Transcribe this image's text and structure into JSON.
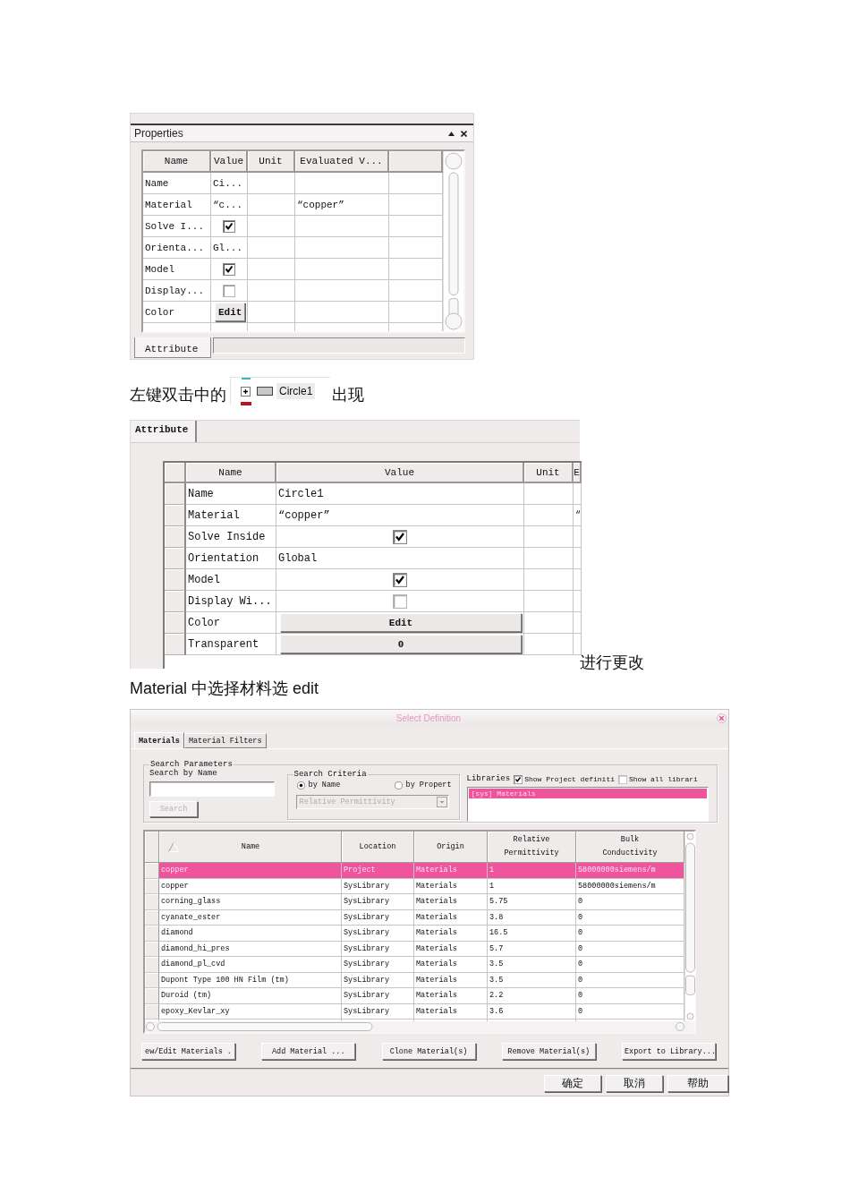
{
  "properties_panel": {
    "title": "Properties",
    "columns": [
      "Name",
      "Value",
      "Unit",
      "Evaluated V..."
    ],
    "rows": [
      {
        "kind": "text",
        "name": "Name",
        "value": "Ci..."
      },
      {
        "kind": "text",
        "name": "Material",
        "value": "“c...",
        "evaluated": "“copper”"
      },
      {
        "kind": "checkbox",
        "name": "Solve I...",
        "checked": true
      },
      {
        "kind": "text",
        "name": "Orienta...",
        "value": "Gl..."
      },
      {
        "kind": "checkbox",
        "name": "Model",
        "checked": true
      },
      {
        "kind": "checkbox",
        "name": "Display...",
        "checked": false
      },
      {
        "kind": "button",
        "name": "Color",
        "value": "Edit"
      }
    ],
    "tab": "Attribute"
  },
  "instruction_1": {
    "before": "左键双击中的",
    "tree_item": {
      "label": "Circle1"
    },
    "after": "出现"
  },
  "attribute_panel": {
    "tab": "Attribute",
    "columns": [
      "Name",
      "Value",
      "Unit",
      "E"
    ],
    "rows": [
      {
        "kind": "text",
        "name": "Name",
        "value": "Circle1"
      },
      {
        "kind": "text",
        "name": "Material",
        "value": "“copper”",
        "column_4": "“"
      },
      {
        "kind": "checkbox",
        "name": "Solve Inside",
        "checked": true
      },
      {
        "kind": "text",
        "name": "Orientation",
        "value": "Global"
      },
      {
        "kind": "checkbox",
        "name": "Model",
        "checked": true
      },
      {
        "kind": "checkbox",
        "name": "Display Wi...",
        "checked": false
      },
      {
        "kind": "button",
        "name": "Color",
        "value": "Edit"
      },
      {
        "kind": "button",
        "name": "Transparent",
        "value": "0"
      }
    ]
  },
  "instruction_2": "进行更改",
  "instruction_3": "Material 中选择材料选 edit",
  "select_definition": {
    "title": "Select Definition",
    "tabs": [
      {
        "label": "Materials",
        "selected": true
      },
      {
        "label": "Material Filters",
        "selected": false
      }
    ],
    "search_parameters": {
      "legend": "Search Parameters",
      "label": "Search by Name",
      "search_button": {
        "label": "Search",
        "disabled": true
      }
    },
    "search_criteria": {
      "legend": "Search Criteria",
      "options": [
        {
          "label": "by Name",
          "selected": true
        },
        {
          "label": "by Propert",
          "selected": false
        }
      ],
      "property_dropdown": {
        "value": "Relative Permittivity",
        "disabled": true
      }
    },
    "libraries": {
      "label": "Libraries",
      "options": [
        {
          "label": "Show Project definiti",
          "checked": true
        },
        {
          "label": "Show all librari",
          "checked": false
        }
      ],
      "items": [
        {
          "label": "[sys] Materials",
          "selected": true
        }
      ]
    },
    "table": {
      "columns": [
        "Name",
        "Location",
        "Origin",
        "Relative Permittivity",
        "Bulk Conductivity"
      ],
      "rows": [
        {
          "cells": [
            "copper",
            "Project",
            "Materials",
            "1",
            "58000000siemens/m"
          ],
          "selected": true
        },
        {
          "cells": [
            "copper",
            "SysLibrary",
            "Materials",
            "1",
            "58000000siemens/m"
          ],
          "selected": false
        },
        {
          "cells": [
            "corning_glass",
            "SysLibrary",
            "Materials",
            "5.75",
            "0"
          ],
          "selected": false
        },
        {
          "cells": [
            "cyanate_ester",
            "SysLibrary",
            "Materials",
            "3.8",
            "0"
          ],
          "selected": false
        },
        {
          "cells": [
            "diamond",
            "SysLibrary",
            "Materials",
            "16.5",
            "0"
          ],
          "selected": false
        },
        {
          "cells": [
            "diamond_hi_pres",
            "SysLibrary",
            "Materials",
            "5.7",
            "0"
          ],
          "selected": false
        },
        {
          "cells": [
            "diamond_pl_cvd",
            "SysLibrary",
            "Materials",
            "3.5",
            "0"
          ],
          "selected": false
        },
        {
          "cells": [
            "Dupont Type 100 HN Film (tm)",
            "SysLibrary",
            "Materials",
            "3.5",
            "0"
          ],
          "selected": false
        },
        {
          "cells": [
            "Duroid (tm)",
            "SysLibrary",
            "Materials",
            "2.2",
            "0"
          ],
          "selected": false
        },
        {
          "cells": [
            "epoxy_Kevlar_xy",
            "SysLibrary",
            "Materials",
            "3.6",
            "0"
          ],
          "selected": false
        }
      ]
    },
    "actions": [
      "ew/Edit Materials .",
      "Add Material ...",
      "Clone Material(s)",
      "Remove Material(s)",
      "Export to Library..."
    ],
    "buttons": [
      "确定",
      "取消",
      "帮助"
    ]
  }
}
